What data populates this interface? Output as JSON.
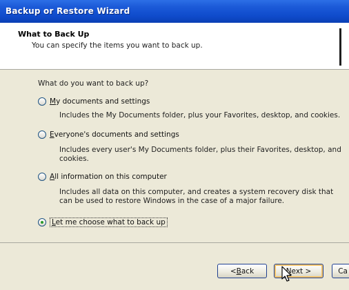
{
  "window": {
    "title": "Backup or Restore Wizard"
  },
  "header": {
    "title": "What to Back Up",
    "subtitle": "You can specify the items you want to back up."
  },
  "question": "What do you want to back up?",
  "options": [
    {
      "mnemonic": "M",
      "label_rest": "y documents and settings",
      "description": "Includes the My Documents folder, plus your Favorites, desktop, and cookies.",
      "selected": false
    },
    {
      "mnemonic": "E",
      "label_rest": "veryone's documents and settings",
      "description": "Includes every user's My Documents folder, plus their Favorites, desktop, and cookies.",
      "selected": false
    },
    {
      "mnemonic": "A",
      "label_rest": "ll information on this computer",
      "description": "Includes all data on this computer, and creates a system recovery disk that can be used to restore Windows in the case of a major failure.",
      "selected": false
    },
    {
      "mnemonic": "L",
      "label_rest": "et me choose what to back up",
      "description": "",
      "selected": true
    }
  ],
  "buttons": {
    "back": {
      "prefix": "< ",
      "mnemonic": "B",
      "rest": "ack"
    },
    "next": {
      "mnemonic": "N",
      "rest": "ext >"
    },
    "cancel": {
      "label": "Ca"
    }
  },
  "colors": {
    "titlebar": "#0f4bcc",
    "dialog_bg": "#ece9d8",
    "radio_dot": "#2a9a2a"
  }
}
